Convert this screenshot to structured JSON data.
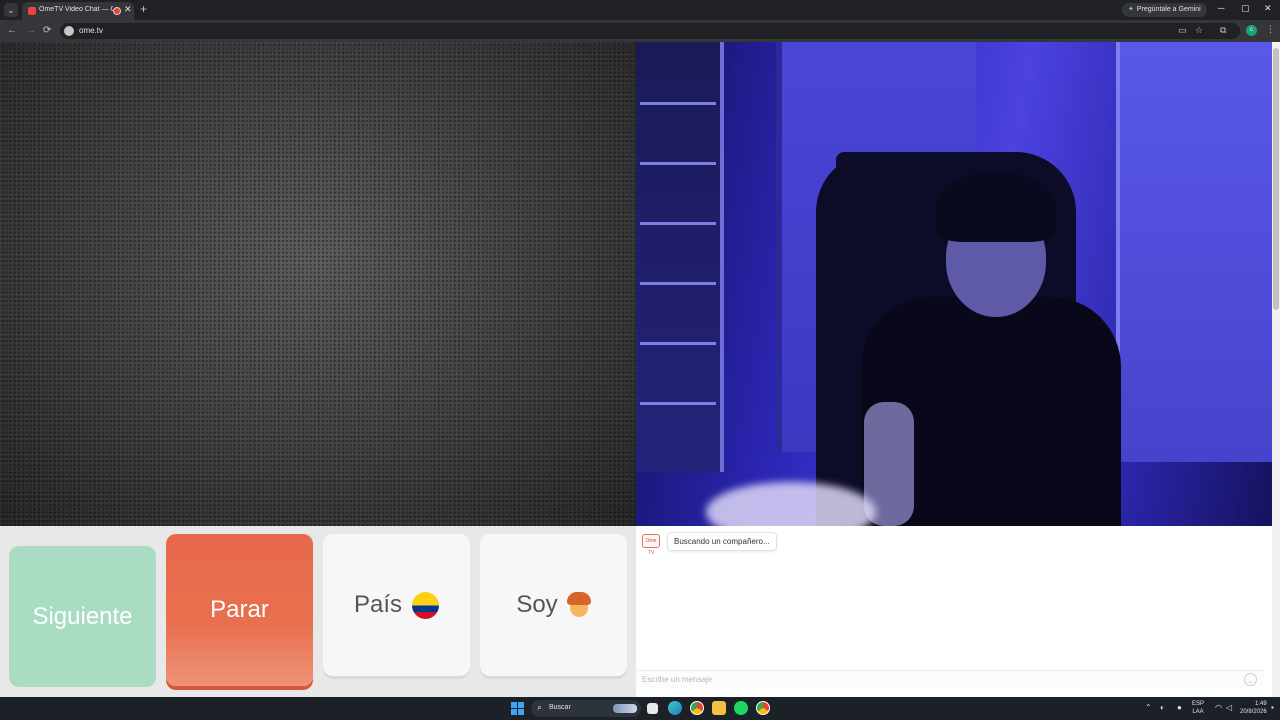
{
  "browser": {
    "tab_title": "OmeTV Video Chat — Ome",
    "tab_close": "✕",
    "new_tab": "+",
    "gemini_label": "Pregúntale a Gemini",
    "gemini_spark": "✦",
    "minimize": "─",
    "maximize": "▢",
    "close": "✕",
    "back": "←",
    "forward": "→",
    "reload": "⟳",
    "url": "ome.tv",
    "profile_initial": "c",
    "menu": "⋮",
    "tab_list": "⌄"
  },
  "controls": {
    "next_label": "Siguiente",
    "stop_label": "Parar",
    "country_label": "País",
    "gender_label": "Soy",
    "country_flag": "colombia-flag",
    "gender_icon": "boy-emoji"
  },
  "chat": {
    "logo_text": "Ome TV",
    "status_message": "Buscando un compañero...",
    "input_placeholder": "Escribe un mensaje"
  },
  "taskbar": {
    "search_label": "Buscar",
    "language_line1": "ESP",
    "language_line2": "LAA",
    "time": "1:49",
    "date": "20/8/2026"
  },
  "colors": {
    "next": "#a9dcc2",
    "stop": "#e8684b",
    "neutral_button": "#f7f7f7"
  }
}
